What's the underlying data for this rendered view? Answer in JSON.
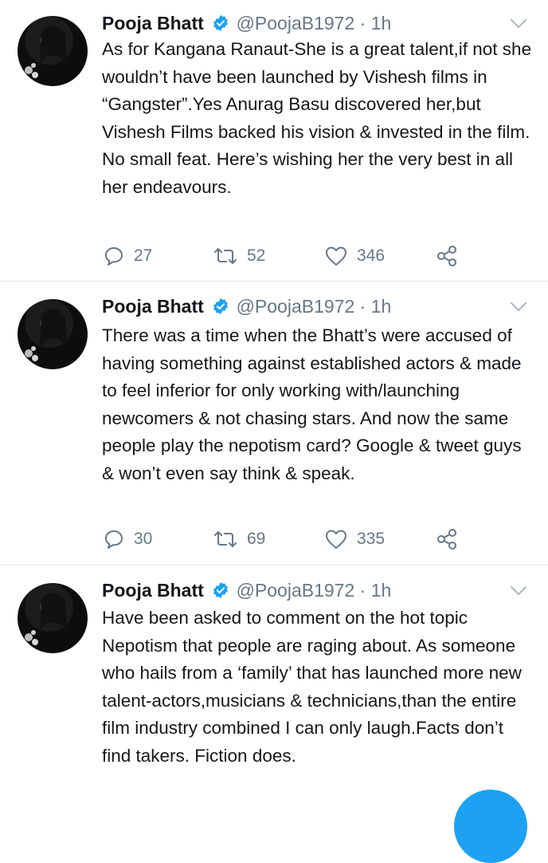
{
  "tweets": [
    {
      "name": "Pooja Bhatt",
      "handle": "@PoojaB1972",
      "time": "· 1h",
      "text": "As for Kangana Ranaut-She is a great talent,if not she wouldn’t have been launched by Vishesh films in “Gangster”.Yes Anurag Basu discovered her,but Vishesh Films backed his vision & invested in the film. No small feat. Here’s wishing her the very best in all her endeavours.",
      "replies": "27",
      "retweets": "52",
      "likes": "346"
    },
    {
      "name": "Pooja Bhatt",
      "handle": "@PoojaB1972",
      "time": "· 1h",
      "text": "There was a time when the Bhatt’s were accused of having something against established actors & made to feel inferior for only working with/launching newcomers & not chasing stars. And now the same people play the nepotism card? Google & tweet guys & won’t even say think & speak.",
      "replies": "30",
      "retweets": "69",
      "likes": "335"
    },
    {
      "name": "Pooja Bhatt",
      "handle": "@PoojaB1972",
      "time": "· 1h",
      "text": "Have been asked to comment on the hot topic Nepotism that people are raging about. As someone who hails from a ‘family’ that has launched more new talent-actors,musicians & technicians,than the entire film industry combined I can only laugh.Facts don’t find takers. Fiction does."
    }
  ],
  "colors": {
    "accent": "#1da1f2",
    "muted": "#657786",
    "divider": "#e1e8ed"
  },
  "icons": [
    "avatar",
    "verified-badge-icon",
    "chevron-down-icon",
    "reply-icon",
    "retweet-icon",
    "like-icon",
    "share-icon",
    "compose-fab"
  ]
}
